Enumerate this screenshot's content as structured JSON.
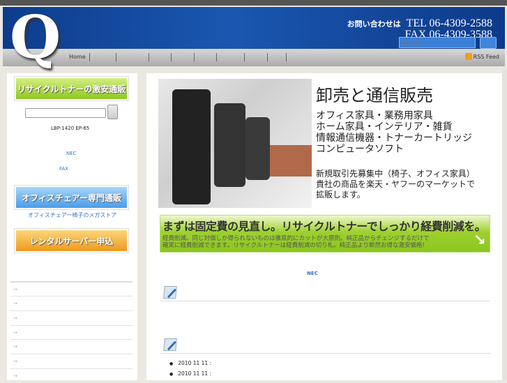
{
  "header": {
    "logo": "Q",
    "contact_label": "お問い合わせは",
    "tel": "TEL 06-4309-2588",
    "fax": "FAX 06-4309-3588",
    "search_placeholder": "Search..."
  },
  "nav": {
    "home": "Home",
    "rss": "RSS Feed"
  },
  "sidebar": {
    "banner1": "リサイクルトナーの激安通販",
    "models": "LBP-1420 EP-65",
    "link_nec": "NEC",
    "link_fax": "FAX",
    "banner2": "オフィスチェアー専門通販",
    "banner2_caption": "オフィスチェアー椅子のメガストア",
    "banner3": "レンタルサーバー申込",
    "list_items": [
      "→",
      "→",
      "→",
      "→",
      "→",
      "→",
      "→"
    ]
  },
  "main": {
    "title": "卸売と通信販売",
    "categories": [
      "オフィス家具・業務用家具",
      "ホーム家具・インテリア・雑貨",
      "情報通信機器・トナーカートリッジ",
      "コンピュータソフト"
    ],
    "recruit": [
      "新規取引先募集中（椅子、オフィス家具）",
      "貴社の商品を楽天・ヤフーのマーケットで",
      "拡販します。"
    ],
    "banner_title": "まずは固定費の見直し。リサイクルトナーでしっかり経費削減を。",
    "banner_sub1": "経費削減。同じ対価しか得られないものは徹底的にカットが大原則。純正品からチェンジするだけで",
    "banner_sub2": "確実に経費削減できます。リサイクルトナーは経費削減の切り札。純正品より断然お得な激安価格!",
    "banner_arrow": "↘",
    "nec_link": "NEC",
    "posts": [
      "2010 11 11 :",
      "2010 11 11 :"
    ]
  }
}
